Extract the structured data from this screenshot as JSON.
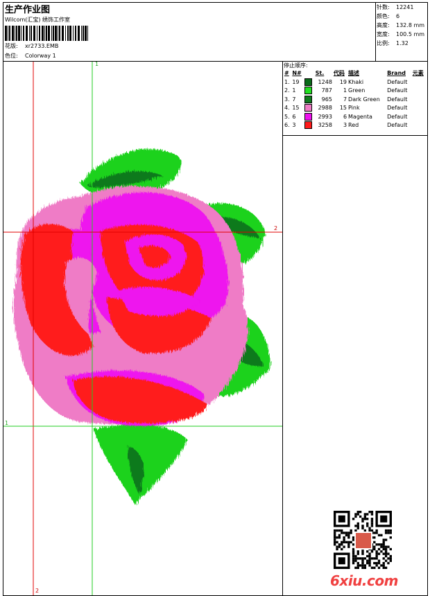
{
  "header": {
    "title": "生产作业图",
    "software": "Wilcom(汇宝) 绣饰工作室",
    "design_label": "花版:",
    "design_value": "xr2733.EMB",
    "colorway_label": "色位:",
    "colorway_value": "Colorway 1"
  },
  "stats": [
    {
      "label": "针数:",
      "value": "12241"
    },
    {
      "label": "颜色:",
      "value": "6"
    },
    {
      "label": "高度:",
      "value": "132.8 mm"
    },
    {
      "label": "宽度:",
      "value": "100.5 mm"
    },
    {
      "label": "比例:",
      "value": "1.32"
    }
  ],
  "stop_sequence": {
    "title": "停止顺序:",
    "columns": [
      "#",
      "N#",
      "St.",
      "代码",
      "描述",
      "Brand",
      "元素"
    ],
    "rows": [
      {
        "idx": "1.",
        "n": "19",
        "color": "#0b6b1a",
        "st": "1248",
        "code": "19",
        "desc": "Khaki",
        "brand": "Default"
      },
      {
        "idx": "2.",
        "n": "1",
        "color": "#22e022",
        "st": "787",
        "code": "1",
        "desc": "Green",
        "brand": "Default"
      },
      {
        "idx": "3.",
        "n": "7",
        "color": "#0f7a1d",
        "st": "965",
        "code": "7",
        "desc": "Dark Green",
        "brand": "Default"
      },
      {
        "idx": "4.",
        "n": "15",
        "color": "#ef7cc6",
        "st": "2988",
        "code": "15",
        "desc": "Pink",
        "brand": "Default"
      },
      {
        "idx": "5.",
        "n": "6",
        "color": "#ee12ee",
        "st": "2993",
        "code": "6",
        "desc": "Magenta",
        "brand": "Default"
      },
      {
        "idx": "6.",
        "n": "3",
        "color": "#ff1a1a",
        "st": "3258",
        "code": "3",
        "desc": "Red",
        "brand": "Default"
      }
    ]
  },
  "guides": {
    "v1": "1",
    "v2": "2",
    "h1": "1",
    "h2": "2"
  },
  "watermark": "6xiu.com",
  "colors": {
    "guide_red": "#e00000",
    "guide_green": "#22cc22"
  }
}
